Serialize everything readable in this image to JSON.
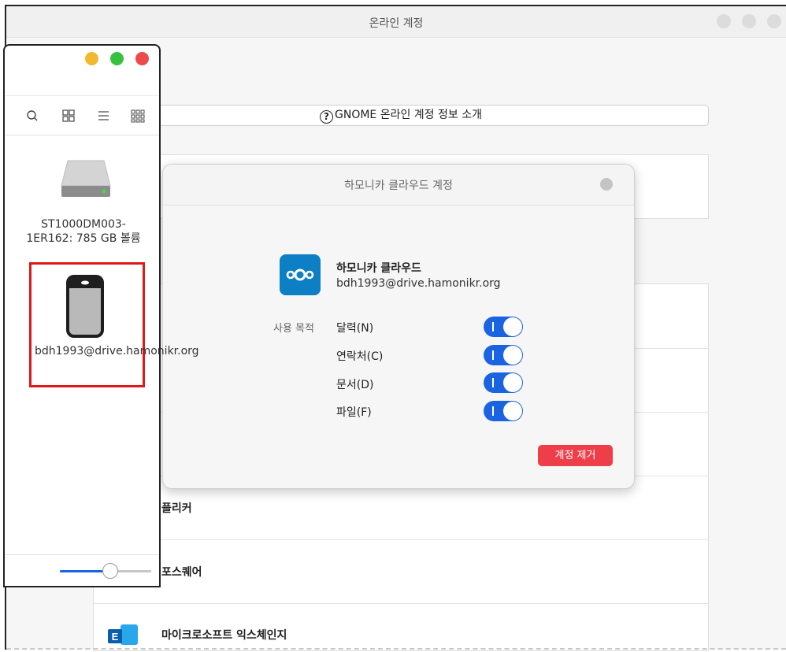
{
  "accounts_window": {
    "title": "온라인 계정",
    "about_button": "GNOME 온라인 계정 정보 소개",
    "providers": [
      {
        "name": "플리커",
        "icon": "flickr-icon"
      },
      {
        "name": "포스퀘어",
        "icon": "foursquare-icon"
      },
      {
        "name": "마이크로소프트 익스체인지",
        "icon": "exchange-icon"
      }
    ]
  },
  "dialog": {
    "title": "하모니카 클라우드 계정",
    "provider_name": "하모니카 클라우드",
    "account_email": "bdh1993@drive.hamonikr.org",
    "usage_label": "사용 목적",
    "usages": [
      {
        "label": "달력(N)",
        "enabled": true
      },
      {
        "label": "연락처(C)",
        "enabled": true
      },
      {
        "label": "문서(D)",
        "enabled": true
      },
      {
        "label": "파일(F)",
        "enabled": true
      }
    ],
    "remove_button": "계정 제거",
    "colors": {
      "switch_on": "#1a63e1",
      "remove": "#ee3e4a",
      "brand": "#0c7fc5"
    }
  },
  "files_window": {
    "volume_label": "ST1000DM003-1ER162: 785 GB 볼륨",
    "drive_label": "bdh1993@drive.hamonikr.org",
    "toolbar_icons": [
      "search-icon",
      "grid-view-icon",
      "list-view-icon",
      "compact-view-icon"
    ],
    "zoom_level": 0.55,
    "colors": {
      "selection": "#e01818"
    }
  }
}
